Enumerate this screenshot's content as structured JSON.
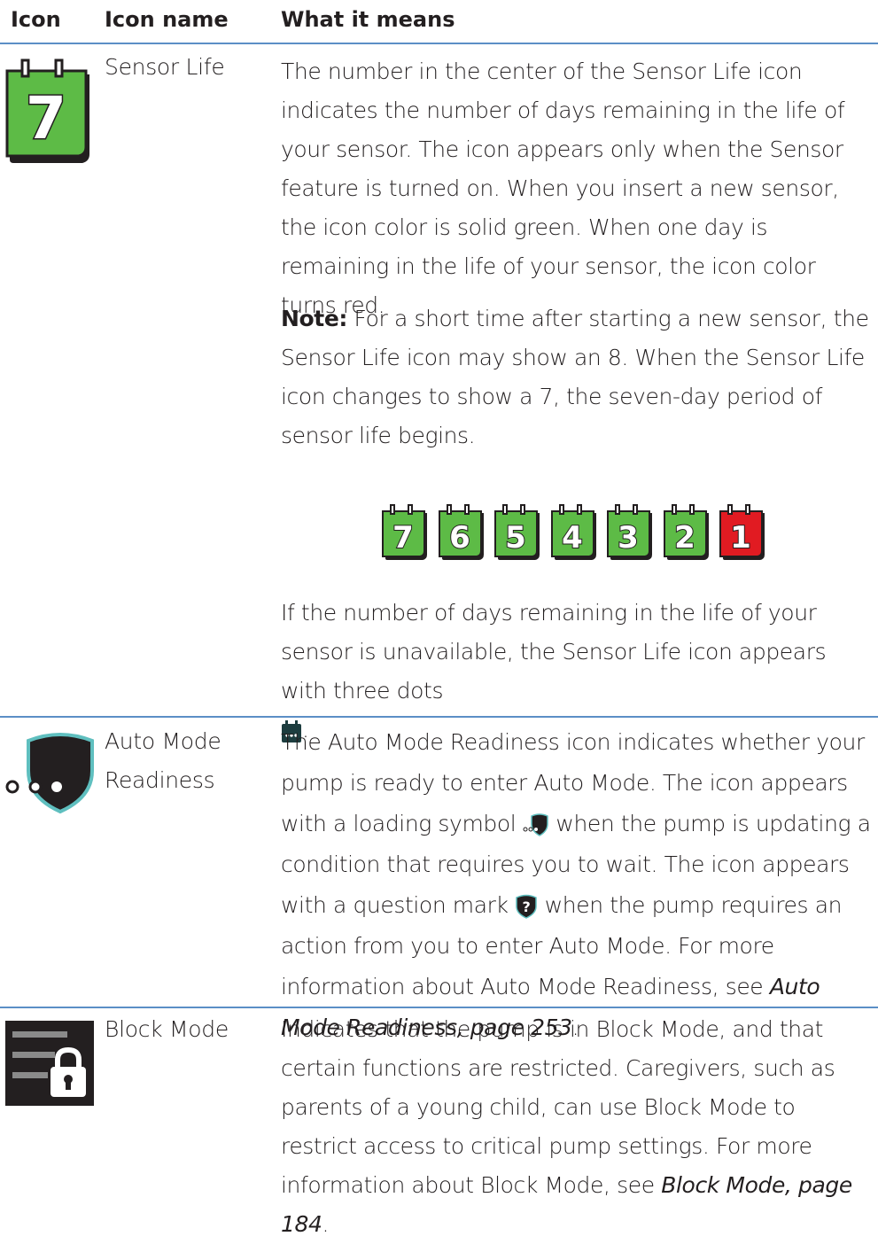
{
  "table": {
    "headers": {
      "icon": "Icon",
      "name": "Icon name",
      "meaning": "What it means"
    },
    "rows": [
      {
        "icon": "sensor-life-icon",
        "icon_number": "7",
        "name": "Sensor Life",
        "text1": "The number in the center of the Sensor Life icon indicates the number of days remaining in the life of your sensor. The icon appears only when the Sensor feature is turned on. When you insert a new sensor, the icon color is solid green. When one day is remaining in the life of your sensor, the icon color turns red.",
        "note_label": "Note:",
        "note_text": " For a short time after starting a new sensor, the Sensor Life icon may show an 8. When the Sensor Life icon changes to show a 7, the seven-day period of sensor life begins.",
        "sequence": [
          {
            "num": "7",
            "color": "#5dbb46"
          },
          {
            "num": "6",
            "color": "#5dbb46"
          },
          {
            "num": "5",
            "color": "#5dbb46"
          },
          {
            "num": "4",
            "color": "#5dbb46"
          },
          {
            "num": "3",
            "color": "#5dbb46"
          },
          {
            "num": "2",
            "color": "#5dbb46"
          },
          {
            "num": "1",
            "color": "#e11b22"
          }
        ],
        "text2": "If the number of days remaining in the life of your sensor is unavailable, the Sensor Life icon appears with three dots",
        "text2_end": "."
      },
      {
        "icon": "auto-mode-readiness-icon",
        "name_line1": "Auto Mode",
        "name_line2": "Readiness",
        "text_a": "The Auto Mode Readiness icon indicates whether your pump is ready to enter Auto Mode. The icon appears with a loading symbol",
        "text_b": " when the pump is updating a condition that requires you to wait. The icon appears with a question mark",
        "text_c": " when the pump requires an action from you to enter Auto Mode. For more information about Auto Mode Readiness, see ",
        "ref": "Auto Mode Readiness, page 253",
        "text_end": "."
      },
      {
        "icon": "block-mode-icon",
        "name": "Block Mode",
        "text": "Indicates that the pump is in Block Mode, and that certain functions are restricted. Caregivers, such as parents of a young child, can use Block Mode to restrict access to critical pump settings. For more information about Block Mode, see ",
        "ref": "Block Mode, page 184",
        "text_end": "."
      }
    ]
  },
  "colors": {
    "rule": "#5b8fc6",
    "green": "#5dbb46",
    "red": "#e11b22",
    "dark": "#231f20",
    "shield_outline": "#5fbfbf"
  }
}
